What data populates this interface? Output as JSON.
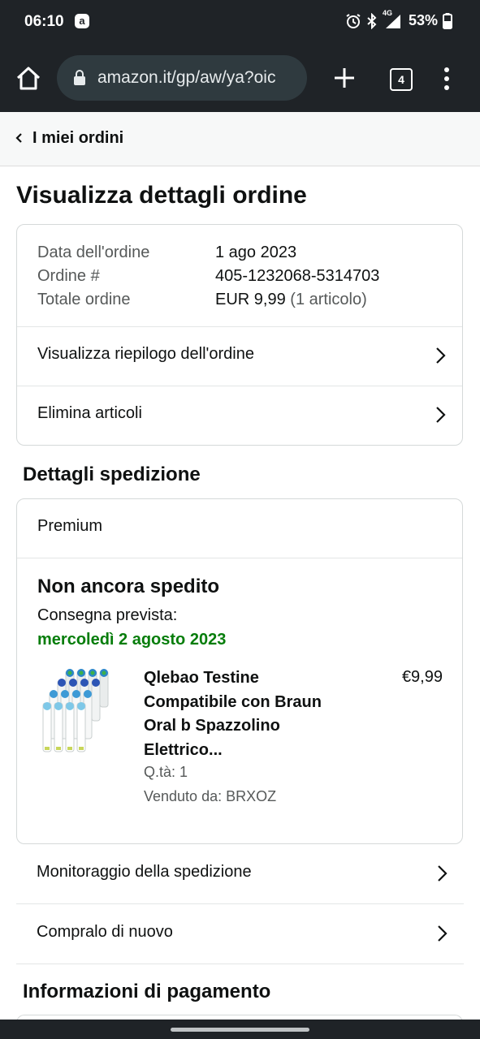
{
  "status_bar": {
    "time": "06:10",
    "app_icon_letter": "a",
    "network": "4G",
    "battery": "53%"
  },
  "browser": {
    "url": "amazon.it/gp/aw/ya?oic",
    "tab_count": "4"
  },
  "breadcrumb": {
    "label": "I miei ordini"
  },
  "page": {
    "title": "Visualizza dettagli ordine"
  },
  "order_summary": {
    "rows": [
      {
        "label": "Data dell'ordine",
        "value": "1 ago 2023"
      },
      {
        "label": "Ordine #",
        "value": "405-1232068-5314703"
      },
      {
        "label": "Totale ordine",
        "value": "EUR 9,99",
        "extra": "(1 articolo)"
      }
    ],
    "links": [
      {
        "label": "Visualizza riepilogo dell'ordine"
      },
      {
        "label": "Elimina articoli"
      }
    ]
  },
  "shipping": {
    "heading": "Dettagli spedizione",
    "type": "Premium",
    "status": "Non ancora spedito",
    "delivery_label": "Consegna prevista:",
    "delivery_date": "mercoledì 2 agosto 2023",
    "product": {
      "title": "Qlebao Testine Compatibile con Braun Oral b Spazzolino Elettrico...",
      "price": "€9,99",
      "quantity": "Q.tà: 1",
      "seller": "Venduto da: BRXOZ"
    },
    "actions": [
      {
        "label": "Monitoraggio della spedizione"
      },
      {
        "label": "Compralo di nuovo"
      }
    ]
  },
  "payment": {
    "heading": "Informazioni di pagamento"
  },
  "colors": {
    "delivery_green": "#067d0b",
    "browser_chrome": "#1f2327",
    "url_bar": "#2f3a3f"
  }
}
